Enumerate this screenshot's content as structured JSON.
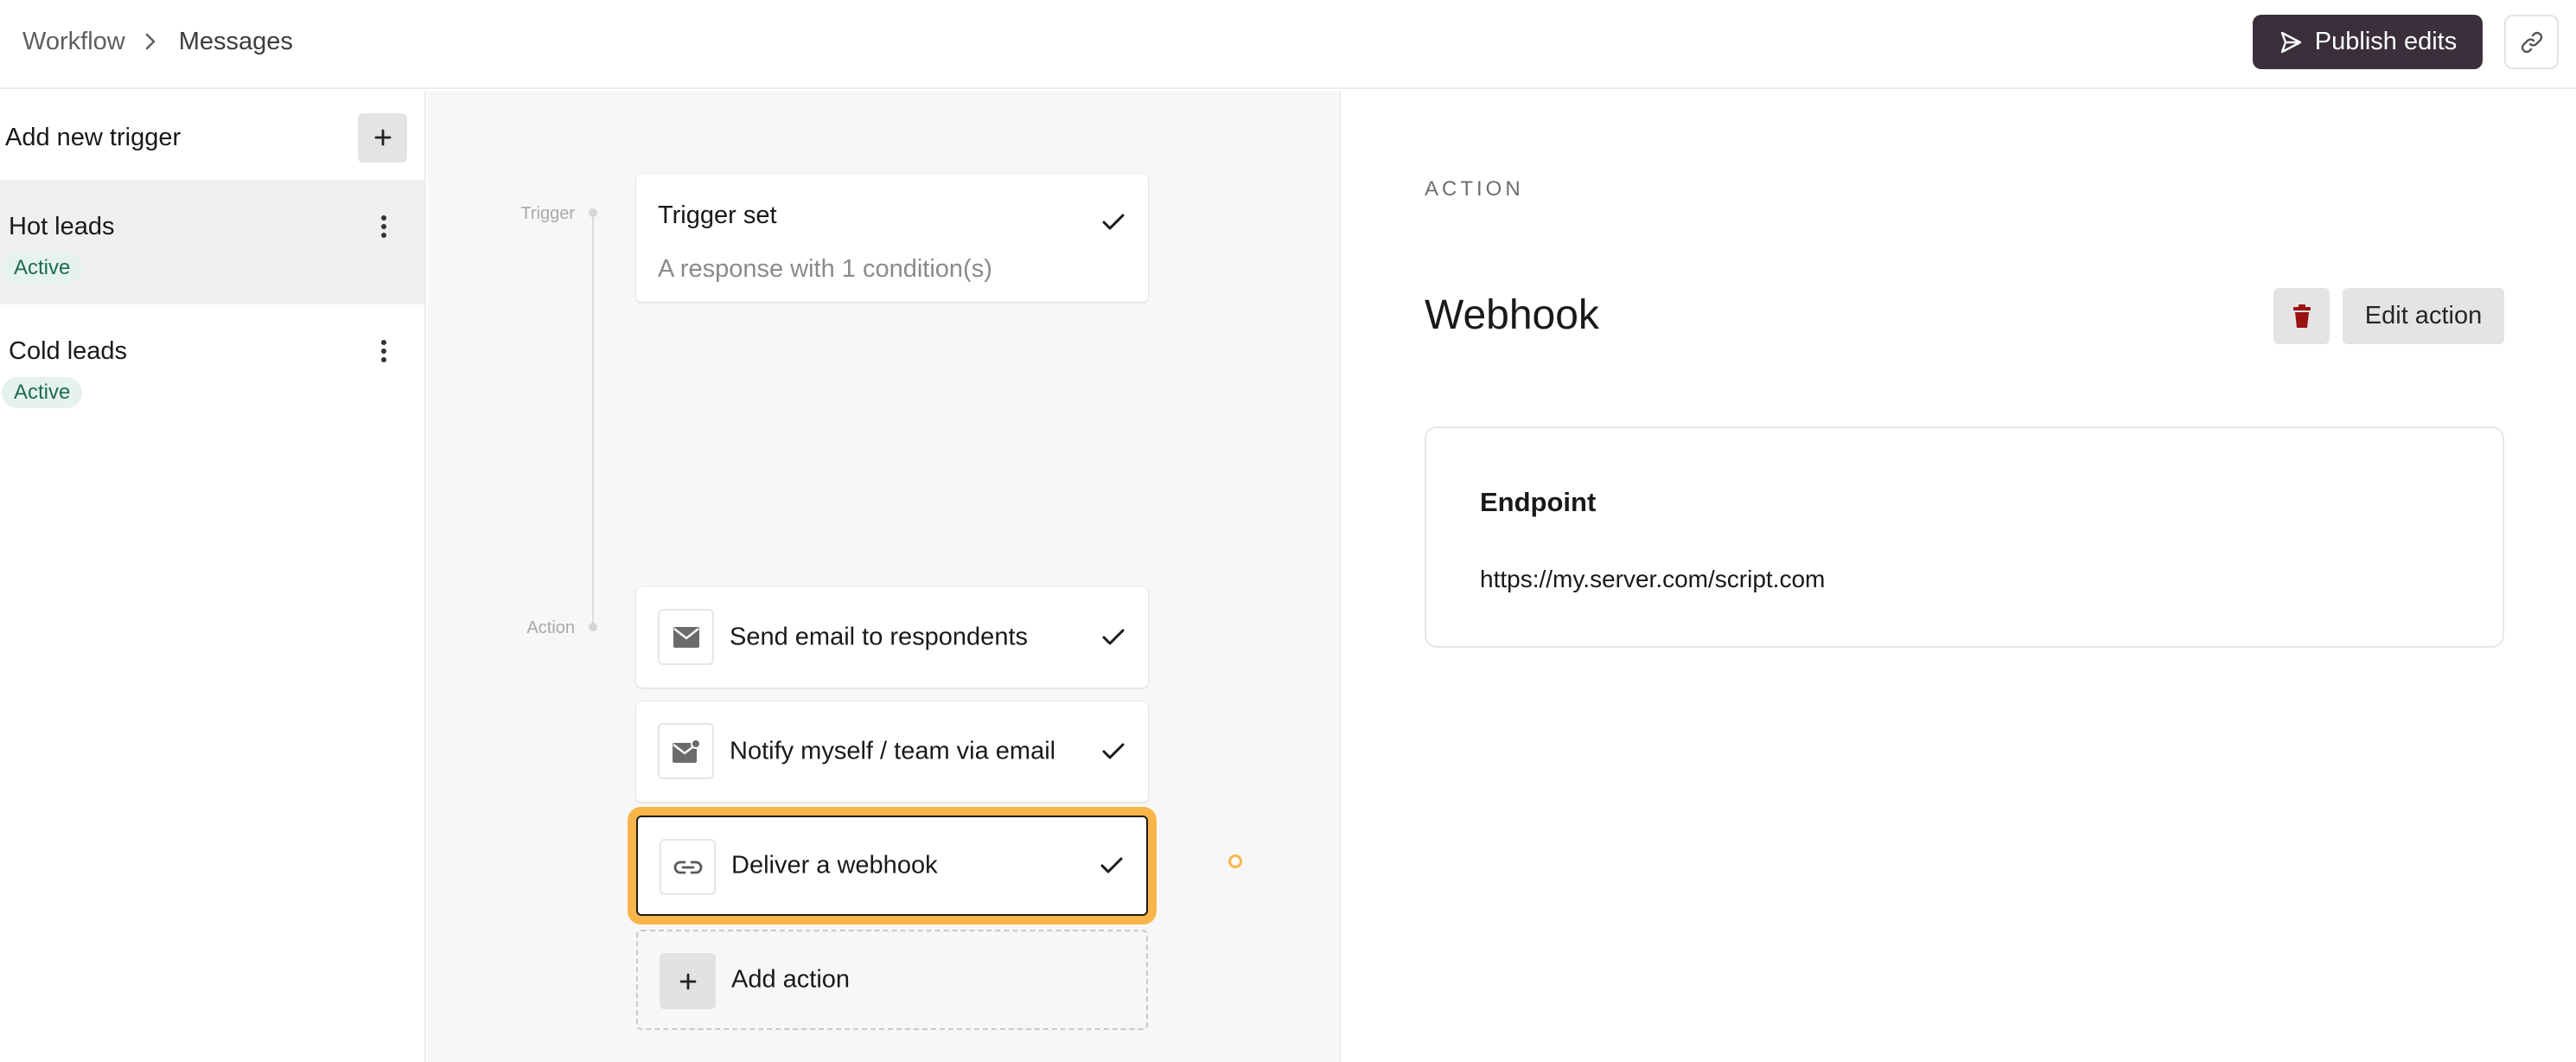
{
  "header": {
    "breadcrumb": [
      "Workflow",
      "Messages"
    ],
    "publish_label": "Publish edits",
    "publish_icon": "send-icon",
    "share_icon": "link-icon",
    "colors": {
      "publish_bg": "#3a2f3a"
    }
  },
  "sidebar": {
    "title": "Add new trigger",
    "add_icon": "plus-icon",
    "items": [
      {
        "name": "Hot leads",
        "status": "Active",
        "selected": true
      },
      {
        "name": "Cold leads",
        "status": "Active",
        "selected": false
      }
    ]
  },
  "canvas": {
    "labels": {
      "trigger": "Trigger",
      "action": "Action"
    },
    "trigger_card": {
      "title": "Trigger set",
      "subtitle": "A response with 1 condition(s)",
      "complete": true
    },
    "actions": [
      {
        "title": "Send email to respondents",
        "icon": "mail-icon",
        "complete": true,
        "active": false
      },
      {
        "title": "Notify myself / team via email",
        "icon": "mail-notify-icon",
        "complete": true,
        "active": false
      },
      {
        "title": "Deliver a webhook",
        "icon": "link-icon",
        "complete": true,
        "active": true
      }
    ],
    "add_action_label": "Add action",
    "colors": {
      "highlight": "#f9b54a"
    }
  },
  "panel": {
    "overline": "ACTION",
    "title": "Webhook",
    "delete_icon": "trash-icon",
    "edit_label": "Edit action",
    "endpoint": {
      "label": "Endpoint",
      "value": "https://my.server.com/script.com"
    },
    "colors": {
      "delete_icon": "#9b1212"
    }
  }
}
